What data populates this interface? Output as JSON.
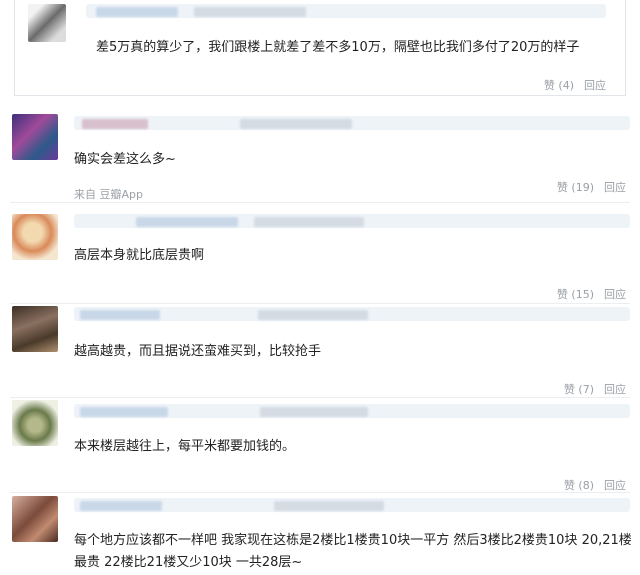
{
  "comments": [
    {
      "text": "差5万真的算少了，我们跟楼上就差了差不多10万，隔壁也比我们多付了20万的样子",
      "like_label": "赞",
      "like_count": "(4)",
      "reply_label": "回应",
      "avatar_color": "#6b6b6b"
    },
    {
      "text": "确实会差这么多~",
      "source": "来自 豆瓣App",
      "like_label": "赞",
      "like_count": "(19)",
      "reply_label": "回应",
      "avatar_color": "#5b4aa0"
    },
    {
      "text": "高层本身就比底层贵啊",
      "like_label": "赞",
      "like_count": "(15)",
      "reply_label": "回应",
      "avatar_color": "#d9a066"
    },
    {
      "text": "越高越贵，而且据说还蛮难买到，比较抢手",
      "like_label": "赞",
      "like_count": "(7)",
      "reply_label": "回应",
      "avatar_color": "#5a4a3a"
    },
    {
      "text": "本来楼层越往上，每平米都要加钱的。",
      "like_label": "赞",
      "like_count": "(8)",
      "reply_label": "回应",
      "avatar_color": "#8a9a6a"
    },
    {
      "text": "每个地方应该都不一样吧 我家现在这栋是2楼比1楼贵10块一平方 然后3楼比2楼贵10块 20,21楼最贵 22楼比21楼又少10块 一共28层~",
      "avatar_color": "#8a5a4a"
    }
  ]
}
